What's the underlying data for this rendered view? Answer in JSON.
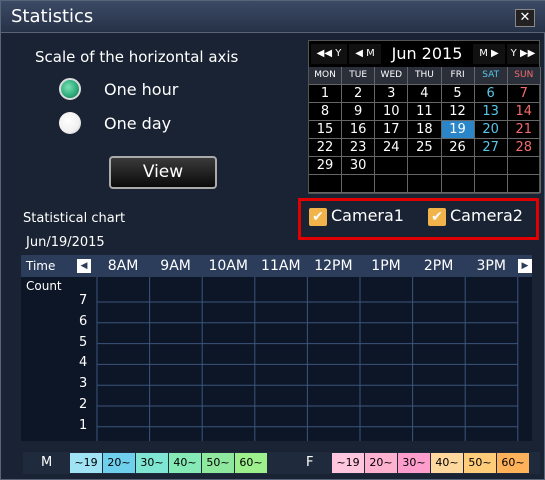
{
  "window": {
    "title": "Statistics",
    "close_label": "✕"
  },
  "scale": {
    "label": "Scale of the horizontal axis",
    "options": [
      {
        "label": "One hour",
        "selected": true
      },
      {
        "label": "One day",
        "selected": false
      }
    ]
  },
  "view_button": "View",
  "calendar": {
    "prev_year": "◀◀ Y",
    "prev_month": "◀ M",
    "month_label": "Jun 2015",
    "next_month": "M ▶",
    "next_year": "Y ▶▶",
    "weekdays": [
      "MON",
      "TUE",
      "WED",
      "THU",
      "FRI",
      "SAT",
      "SUN"
    ],
    "weeks": [
      [
        "1",
        "2",
        "3",
        "4",
        "5",
        "6",
        "7"
      ],
      [
        "8",
        "9",
        "10",
        "11",
        "12",
        "13",
        "14"
      ],
      [
        "15",
        "16",
        "17",
        "18",
        "19",
        "20",
        "21"
      ],
      [
        "22",
        "23",
        "24",
        "25",
        "26",
        "27",
        "28"
      ],
      [
        "29",
        "30",
        "",
        "",
        "",
        "",
        ""
      ],
      [
        "",
        "",
        "",
        "",
        "",
        "",
        ""
      ]
    ],
    "selected_day": "19"
  },
  "chart_section": {
    "label": "Statistical chart",
    "date": "Jun/19/2015"
  },
  "cameras": [
    {
      "label": "Camera1",
      "checked": true
    },
    {
      "label": "Camera2",
      "checked": true
    }
  ],
  "chart": {
    "time_label": "Time",
    "count_label": "Count",
    "hours": [
      "8AM",
      "9AM",
      "10AM",
      "11AM",
      "12PM",
      "1PM",
      "2PM",
      "3PM"
    ],
    "y_ticks": [
      "7",
      "6",
      "5",
      "4",
      "3",
      "2",
      "1"
    ]
  },
  "legend": {
    "male_label": "M",
    "female_label": "F",
    "male": [
      {
        "label": "~19",
        "color": "#9fe3f5"
      },
      {
        "label": "20~",
        "color": "#6fd0ee"
      },
      {
        "label": "30~",
        "color": "#7ee6d2"
      },
      {
        "label": "40~",
        "color": "#86eab7"
      },
      {
        "label": "50~",
        "color": "#8ee89e"
      },
      {
        "label": "60~",
        "color": "#9ef08c"
      }
    ],
    "female": [
      {
        "label": "~19",
        "color": "#ffc6de"
      },
      {
        "label": "20~",
        "color": "#ffb2d0"
      },
      {
        "label": "30~",
        "color": "#ff9ecd"
      },
      {
        "label": "40~",
        "color": "#ffd89e"
      },
      {
        "label": "50~",
        "color": "#ffcc7a"
      },
      {
        "label": "60~",
        "color": "#ffb25a"
      }
    ]
  }
}
